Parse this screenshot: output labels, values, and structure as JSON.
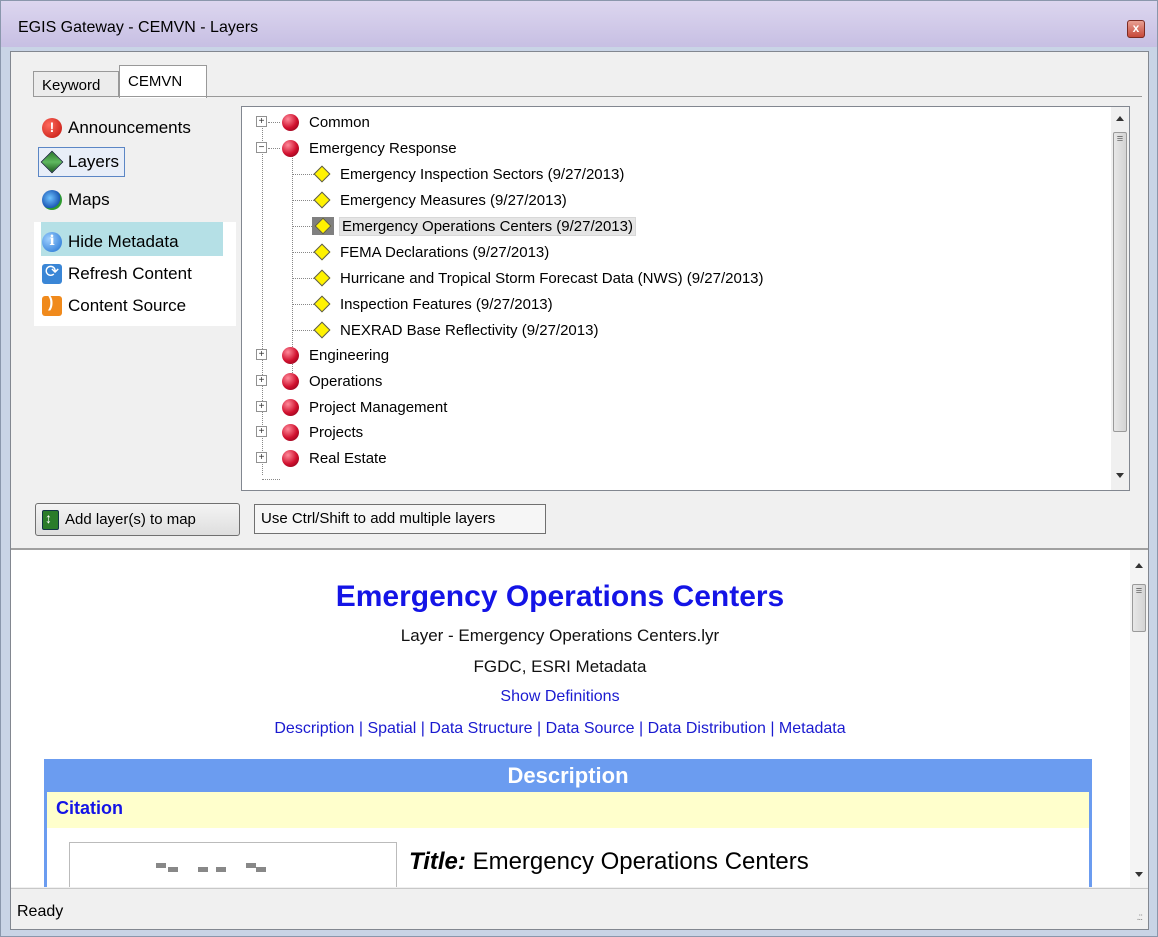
{
  "window": {
    "title": "EGIS Gateway - CEMVN - Layers",
    "close_glyph": "x"
  },
  "tabs": [
    {
      "label": "Keyword"
    },
    {
      "label": "CEMVN"
    }
  ],
  "sidebar": {
    "items": [
      {
        "label": "Announcements",
        "icon": "alert-icon"
      },
      {
        "label": "Layers",
        "icon": "layers-icon"
      },
      {
        "label": "Maps",
        "icon": "globe-icon"
      }
    ],
    "actions": [
      {
        "label": "Hide Metadata",
        "icon": "info-icon"
      },
      {
        "label": "Refresh Content",
        "icon": "refresh-icon"
      },
      {
        "label": "Content Source",
        "icon": "rss-icon"
      }
    ]
  },
  "tree": {
    "groups_top": [
      {
        "label": "Common",
        "expanded": false
      }
    ],
    "expanded_group": {
      "label": "Emergency Response",
      "children": [
        "Emergency Inspection Sectors (9/27/2013)",
        "Emergency Measures (9/27/2013)",
        "Emergency Operations Centers (9/27/2013)",
        "FEMA Declarations (9/27/2013)",
        "Hurricane and Tropical Storm Forecast Data (NWS) (9/27/2013)",
        "Inspection Features (9/27/2013)",
        "NEXRAD Base Reflectivity (9/27/2013)"
      ],
      "selected_index": 2
    },
    "groups_bottom": [
      {
        "label": "Engineering"
      },
      {
        "label": "Operations"
      },
      {
        "label": "Project Management"
      },
      {
        "label": "Projects"
      },
      {
        "label": "Real Estate"
      }
    ],
    "expand_glyph": "+",
    "collapse_glyph": "−"
  },
  "buttons": {
    "add_layers": "Add layer(s) to map",
    "hint": "Use Ctrl/Shift to add multiple layers"
  },
  "metadata": {
    "title": "Emergency Operations Centers",
    "layer_line": "Layer - Emergency Operations Centers.lyr",
    "format_line": "FGDC, ESRI Metadata",
    "show_definitions": "Show Definitions",
    "nav_links": [
      "Description",
      "Spatial",
      "Data Structure",
      "Data Source",
      "Data Distribution",
      "Metadata"
    ],
    "nav_separator": " | ",
    "section": "Description",
    "subsection": "Citation",
    "title_field_label": "Title:",
    "title_field_value": "Emergency Operations Centers"
  },
  "status": {
    "text": "Ready"
  },
  "colors": {
    "title_blue": "#1414e6",
    "section_band": "#6b9cf0",
    "citation_band": "#ffffcc",
    "group_ball": "#d0102e",
    "layer_diamond": "#fff200"
  }
}
